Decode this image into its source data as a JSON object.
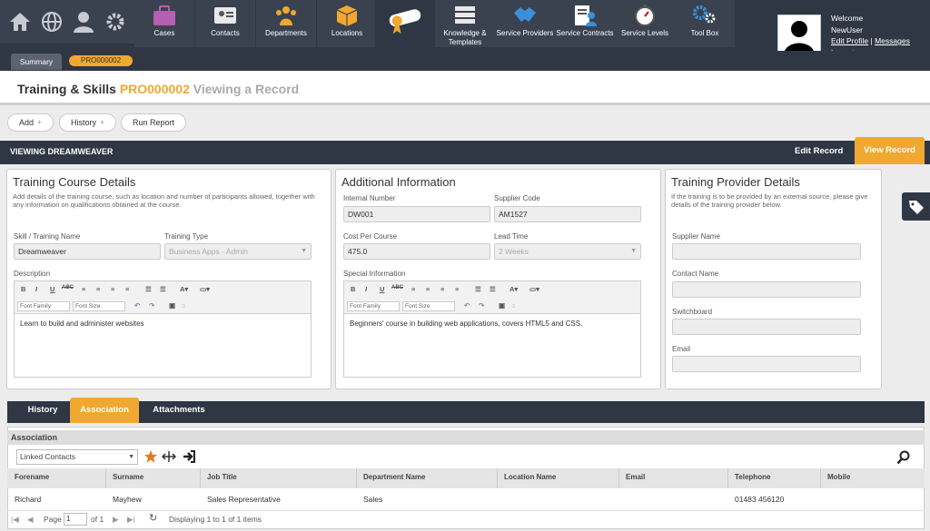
{
  "nav": {
    "items": [
      {
        "label": "Cases"
      },
      {
        "label": "Contacts"
      },
      {
        "label": "Departments"
      },
      {
        "label": "Locations"
      },
      {
        "label": ""
      },
      {
        "label": "Knowledge &\nTemplates"
      },
      {
        "label": "Service Providers"
      },
      {
        "label": "Service Contracts"
      },
      {
        "label": "Service Levels"
      },
      {
        "label": "Tool Box"
      }
    ]
  },
  "user": {
    "welcome": "Welcome",
    "name": "NewUser",
    "edit_profile": "Edit Profile",
    "sep": "|",
    "messages": "Messages",
    "logout": "Logout"
  },
  "tabs": {
    "summary": "Summary",
    "record_code": "PRO000002"
  },
  "page": {
    "title": "Training & Skills",
    "code": "PRO000002",
    "mode": "Viewing a Record"
  },
  "toolbar": {
    "add": "Add",
    "history": "History",
    "run_report": "Run Report",
    "plus": "+"
  },
  "viewbar": {
    "label": "VIEWING DREAMWEAVER",
    "edit": "Edit Record",
    "view": "View Record"
  },
  "course": {
    "heading": "Training Course Details",
    "desc": "Add details of the training course, such as location and number of participants allowed, together with any information on qualifications obtained at the course.",
    "skill_label": "Skill / Training Name",
    "skill_value": "Dreamweaver",
    "type_label": "Training Type",
    "type_value": "Business Apps - Admin",
    "description_label": "Description",
    "description_text": "Learn to build and administer websites"
  },
  "additional": {
    "heading": "Additional Information",
    "internal_label": "Internal Number",
    "internal_value": "DW001",
    "supplier_code_label": "Supplier Code",
    "supplier_code_value": "AM1527",
    "cost_label": "Cost Per Course",
    "cost_value": "475.0",
    "lead_label": "Lead Time",
    "lead_value": "2 Weeks",
    "special_label": "Special Information",
    "special_text": "Beginners' course in building web applications, covers HTML5 and CSS."
  },
  "provider": {
    "heading": "Training Provider Details",
    "desc": "If the training is to be provided by an external source, please give details of the training provider below.",
    "supplier_name": "Supplier Name",
    "contact_name": "Contact Name",
    "switchboard": "Switchboard",
    "email": "Email"
  },
  "editor": {
    "font_family": "Font Family",
    "font_size": "Font Size",
    "bold": "B",
    "italic": "I",
    "underline": "U",
    "strike": "ABC"
  },
  "bottom_tabs": {
    "history": "History",
    "association": "Association",
    "attachments": "Attachments"
  },
  "association": {
    "heading": "Association",
    "select_value": "Linked Contacts",
    "columns": [
      "Forename",
      "Surname",
      "Job Title",
      "Department Name",
      "Location Name",
      "Email",
      "Telephone",
      "Mobile"
    ],
    "rows": [
      [
        "Richard",
        "Mayhew",
        "Sales Representative",
        "Sales",
        "",
        "",
        "01483 456120",
        ""
      ]
    ]
  },
  "pager": {
    "page": "Page",
    "page_value": "1",
    "of": "of 1",
    "status": "Displaying 1 to 1 of 1 items"
  },
  "colors": {
    "accent": "#f0a830",
    "dark": "#2f3744"
  }
}
